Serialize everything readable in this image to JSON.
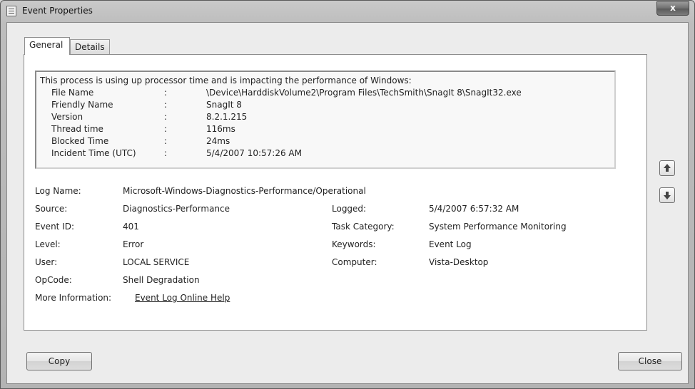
{
  "window": {
    "title": "Event Properties",
    "close_glyph": "x"
  },
  "tabs": [
    {
      "label": "General"
    },
    {
      "label": "Details"
    }
  ],
  "description": {
    "header": "This process is using up processor time and is impacting the performance of Windows:",
    "separator": ":",
    "rows": [
      {
        "key": "File Name",
        "value": "\\Device\\HarddiskVolume2\\Program Files\\TechSmith\\SnagIt 8\\SnagIt32.exe"
      },
      {
        "key": "Friendly Name",
        "value": "SnagIt 8"
      },
      {
        "key": "Version",
        "value": "8.2.1.215"
      },
      {
        "key": "Thread time",
        "value": "116ms"
      },
      {
        "key": "Blocked Time",
        "value": "24ms"
      },
      {
        "key": "Incident Time (UTC)",
        "value": "5/4/2007 10:57:26 AM"
      }
    ]
  },
  "fields": {
    "log_name": {
      "label": "Log Name:",
      "value": "Microsoft-Windows-Diagnostics-Performance/Operational"
    },
    "source": {
      "label": "Source:",
      "value": "Diagnostics-Performance"
    },
    "logged": {
      "label": "Logged:",
      "value": "5/4/2007 6:57:32 AM"
    },
    "event_id": {
      "label": "Event ID:",
      "value": "401"
    },
    "task_category": {
      "label": "Task Category:",
      "value": "System Performance Monitoring"
    },
    "level": {
      "label": "Level:",
      "value": "Error"
    },
    "keywords": {
      "label": "Keywords:",
      "value": "Event Log"
    },
    "user": {
      "label": "User:",
      "value": "LOCAL SERVICE"
    },
    "computer": {
      "label": "Computer:",
      "value": "Vista-Desktop"
    },
    "opcode": {
      "label": "OpCode:",
      "value": "Shell Degradation"
    },
    "more_info": {
      "label": "More Information:",
      "value": "Event Log Online Help"
    }
  },
  "side_buttons": {
    "up_icon": "arrow-up-icon",
    "down_icon": "arrow-down-icon"
  },
  "buttons": {
    "copy": "Copy",
    "close": "Close"
  }
}
